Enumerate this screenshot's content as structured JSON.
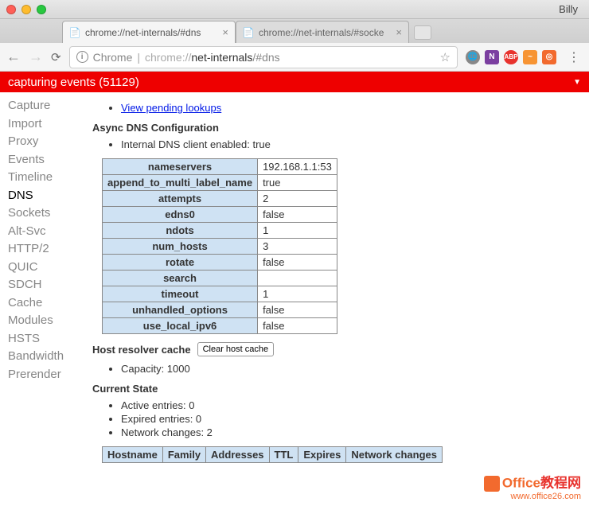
{
  "browser": {
    "profile_name": "Billy",
    "tabs": [
      {
        "title": "chrome://net-internals/#dns",
        "active": true
      },
      {
        "title": "chrome://net-internals/#socke",
        "active": false
      }
    ],
    "url_label": "Chrome",
    "url_scheme": "chrome://",
    "url_host": "net-internals",
    "url_path": "/#dns"
  },
  "banner": {
    "text": "capturing events (51129)"
  },
  "sidebar": {
    "items": [
      {
        "label": "Capture"
      },
      {
        "label": "Import"
      },
      {
        "label": "Proxy"
      },
      {
        "label": "Events"
      },
      {
        "label": "Timeline"
      },
      {
        "label": "DNS",
        "active": true
      },
      {
        "label": "Sockets"
      },
      {
        "label": "Alt-Svc"
      },
      {
        "label": "HTTP/2"
      },
      {
        "label": "QUIC"
      },
      {
        "label": "SDCH"
      },
      {
        "label": "Cache"
      },
      {
        "label": "Modules"
      },
      {
        "label": "HSTS"
      },
      {
        "label": "Bandwidth"
      },
      {
        "label": "Prerender"
      }
    ]
  },
  "main": {
    "pending_link": "View pending lookups",
    "async_title": "Async DNS Configuration",
    "internal_client": "Internal DNS client enabled: true",
    "config_rows": [
      {
        "key": "nameservers",
        "value": "192.168.1.1:53"
      },
      {
        "key": "append_to_multi_label_name",
        "value": "true"
      },
      {
        "key": "attempts",
        "value": "2"
      },
      {
        "key": "edns0",
        "value": "false"
      },
      {
        "key": "ndots",
        "value": "1"
      },
      {
        "key": "num_hosts",
        "value": "3"
      },
      {
        "key": "rotate",
        "value": "false"
      },
      {
        "key": "search",
        "value": ""
      },
      {
        "key": "timeout",
        "value": "1"
      },
      {
        "key": "unhandled_options",
        "value": "false"
      },
      {
        "key": "use_local_ipv6",
        "value": "false"
      }
    ],
    "resolver_title": "Host resolver cache",
    "clear_button": "Clear host cache",
    "capacity": "Capacity: 1000",
    "current_state_title": "Current State",
    "state_items": [
      "Active entries: 0",
      "Expired entries: 0",
      "Network changes: 2"
    ],
    "state_columns": [
      "Hostname",
      "Family",
      "Addresses",
      "TTL",
      "Expires",
      "Network changes"
    ]
  },
  "watermark": {
    "line1a": "Office",
    "line1b": "教程网",
    "line2": "www.office26.com"
  }
}
